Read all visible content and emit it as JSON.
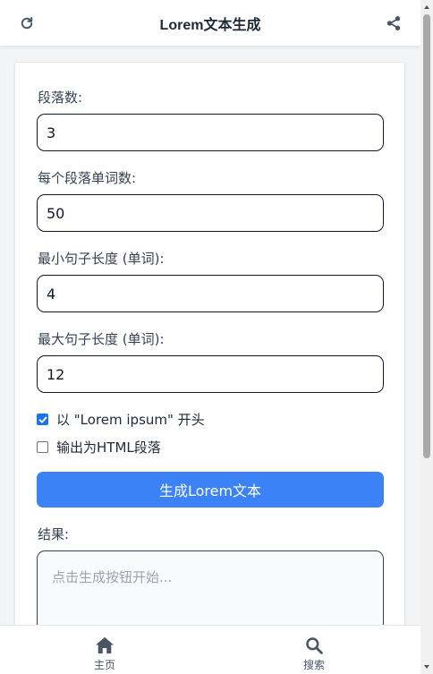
{
  "header": {
    "title": "Lorem文本生成",
    "refresh_icon": "refresh-icon",
    "share_icon": "share-icon"
  },
  "form": {
    "paragraphs": {
      "label": "段落数:",
      "value": "3"
    },
    "words_per_paragraph": {
      "label": "每个段落单词数:",
      "value": "50"
    },
    "min_sentence_length": {
      "label": "最小句子长度 (单词):",
      "value": "4"
    },
    "max_sentence_length": {
      "label": "最大句子长度 (单词):",
      "value": "12"
    },
    "start_with_lorem": {
      "label": "以 \"Lorem ipsum\" 开头",
      "checked": true
    },
    "html_paragraphs": {
      "label": "输出为HTML段落",
      "checked": false
    },
    "generate_button": "生成Lorem文本"
  },
  "result": {
    "label": "结果:",
    "placeholder": "点击生成按钮开始..."
  },
  "bottom_nav": {
    "items": [
      {
        "label": "主页",
        "icon": "home-icon"
      },
      {
        "label": "搜索",
        "icon": "search-icon"
      }
    ]
  },
  "colors": {
    "accent": "#3b82f6",
    "checkbox": "#1a73e8",
    "icon": "#4b5563"
  }
}
